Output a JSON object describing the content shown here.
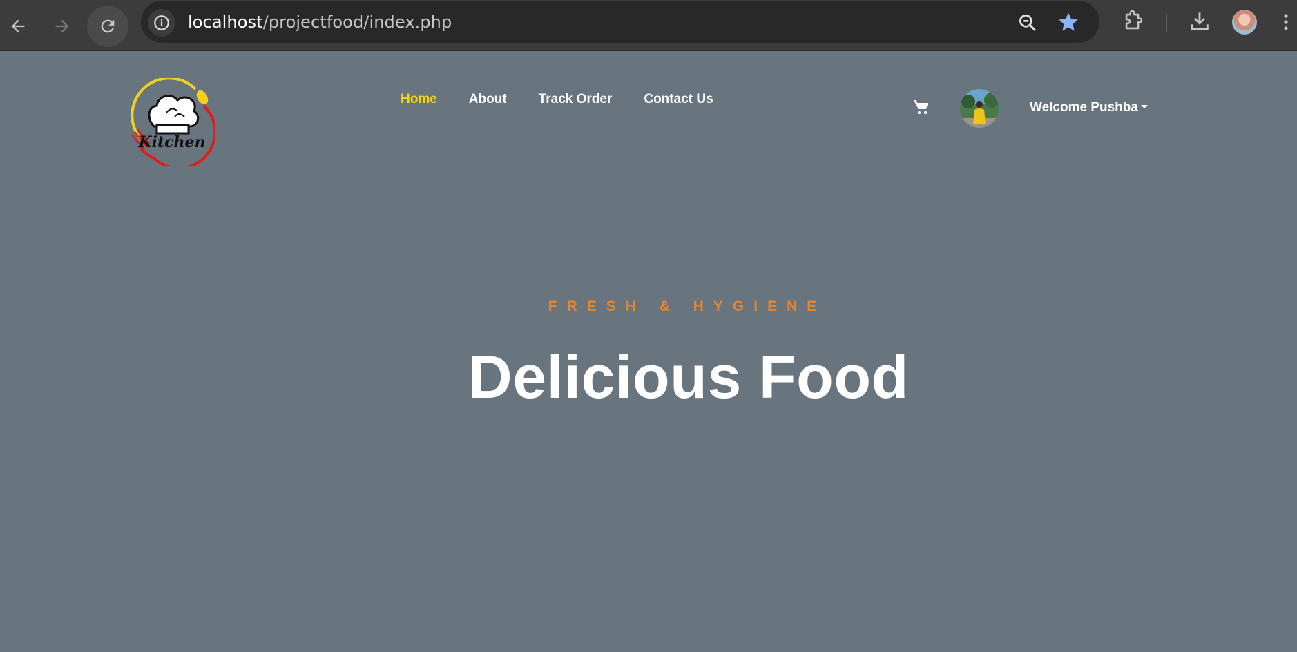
{
  "browser": {
    "url_host": "localhost",
    "url_path": "/projectfood/index.php"
  },
  "site": {
    "logo_text": "Kitchen",
    "nav": [
      {
        "label": "Home",
        "active": true
      },
      {
        "label": "About"
      },
      {
        "label": "Track Order"
      },
      {
        "label": "Contact Us"
      }
    ],
    "welcome_label": "Welcome Pushba"
  },
  "hero": {
    "tagline": "FRESH & HYGIENE",
    "title": "Delicious Food"
  },
  "colors": {
    "page_bg": "#68757f",
    "nav_active": "#ffd700",
    "tagline": "#e8842c",
    "chrome_bg": "#3c3c3c",
    "star": "#8ab4f8"
  },
  "icons": {
    "back": "arrow-left-icon",
    "forward": "arrow-right-icon",
    "reload": "reload-icon",
    "site_info": "info-icon",
    "zoom": "zoom-out-icon",
    "bookmark": "star-icon",
    "extensions": "puzzle-icon",
    "downloads": "download-icon",
    "menu": "kebab-menu-icon",
    "cart": "shopping-cart-icon"
  }
}
